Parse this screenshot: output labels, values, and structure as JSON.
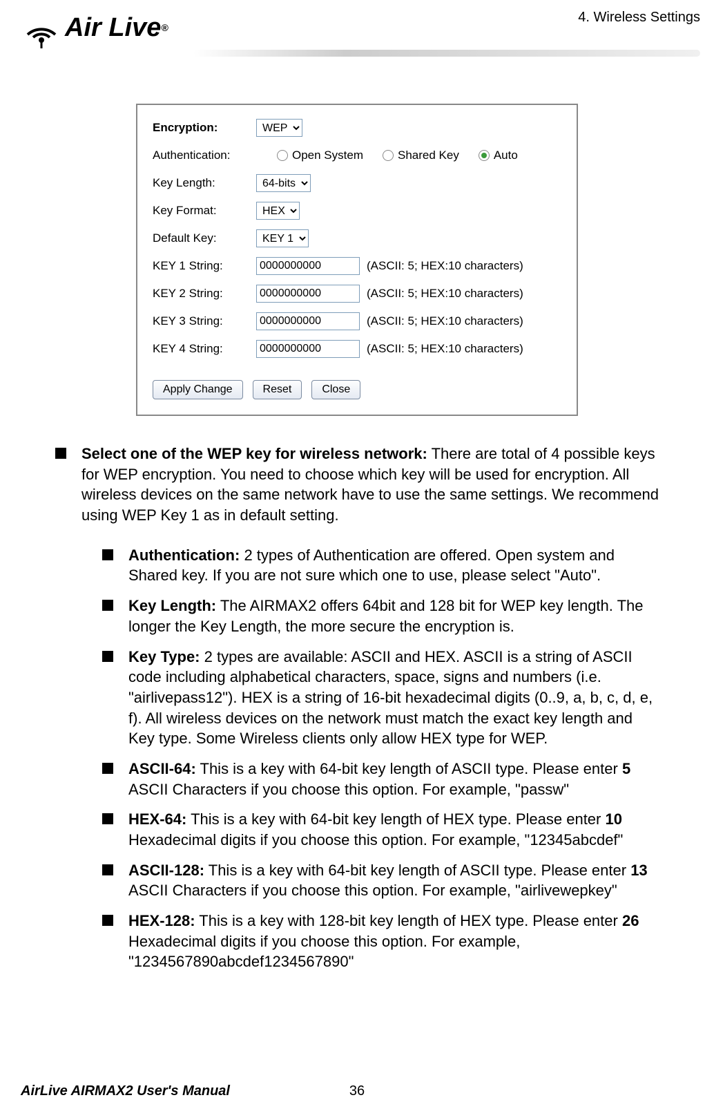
{
  "header": {
    "logo_text": "Air Live",
    "breadcrumb": "4.  Wireless  Settings"
  },
  "panel": {
    "encryption_label": "Encryption:",
    "encryption_value": "WEP",
    "auth_label": "Authentication:",
    "auth_options": {
      "open": "Open System",
      "shared": "Shared Key",
      "auto": "Auto"
    },
    "keylen_label": "Key Length:",
    "keylen_value": "64-bits",
    "keyfmt_label": "Key Format:",
    "keyfmt_value": "HEX",
    "defkey_label": "Default Key:",
    "defkey_value": "KEY 1",
    "k1_label": "KEY 1 String:",
    "k2_label": "KEY 2 String:",
    "k3_label": "KEY 3 String:",
    "k4_label": "KEY 4 String:",
    "key_value": "0000000000",
    "key_hint": "(ASCII: 5; HEX:10 characters)",
    "btn_apply": "Apply Change",
    "btn_reset": "Reset",
    "btn_close": "Close"
  },
  "bullets": {
    "main_title": "Select one of the WEP key for wireless network:",
    "main_text": "   There are total of 4 possible keys for WEP encryption.   You need to choose which key will be used for encryption.   All wireless devices on the same network have to use the same settings.   We recommend using WEP Key 1 as in default setting.",
    "auth_title": "Authentication:",
    "auth_text": "   2 types of Authentication are offered.   Open system and Shared key.   If you are not sure which one to use, please select \"Auto\".",
    "keylen_title": "Key Length:",
    "keylen_text": "   The AIRMAX2 offers 64bit and 128 bit for WEP key length.   The longer the Key Length, the more secure the encryption is.",
    "keytype_title": "Key Type:",
    "keytype_text": "   2 types are available: ASCII and HEX.   ASCII is a string of ASCII code including alphabetical characters, space, signs and numbers (i.e. \"airlivepass12\").   HEX is a string of 16-bit hexadecimal digits (0..9, a, b, c, d, e, f). All wireless devices on the network must match the exact key length and Key type. Some Wireless clients only allow HEX type for WEP.",
    "a64_title": "ASCII-64:",
    "a64_text_a": " This is a key with 64-bit key length of ASCII type.   Please enter ",
    "a64_bold": "5",
    "a64_text_b": " ASCII Characters if you choose this option. For example, \"passw\"",
    "h64_title": "HEX-64:",
    "h64_text_a": " This is a key with 64-bit key length of HEX type.   Please enter ",
    "h64_bold": "10",
    "h64_text_b": " Hexadecimal digits if you choose this option. For example, \"12345abcdef\"",
    "a128_title": "ASCII-128:",
    "a128_text_a": " This is a key with 64-bit key length of ASCII type.   Please enter ",
    "a128_bold": "13",
    "a128_text_b": " ASCII Characters if you choose this option. For example, \"airlivewepkey\"",
    "h128_title": "HEX-128:",
    "h128_text_a": " This is a key with 128-bit key length of HEX type.   Please enter ",
    "h128_bold": "26",
    "h128_text_b": " Hexadecimal digits if you choose this option. For example, \"1234567890abcdef1234567890\""
  },
  "footer": {
    "manual": "AirLive AIRMAX2 User's Manual",
    "page": "36"
  }
}
